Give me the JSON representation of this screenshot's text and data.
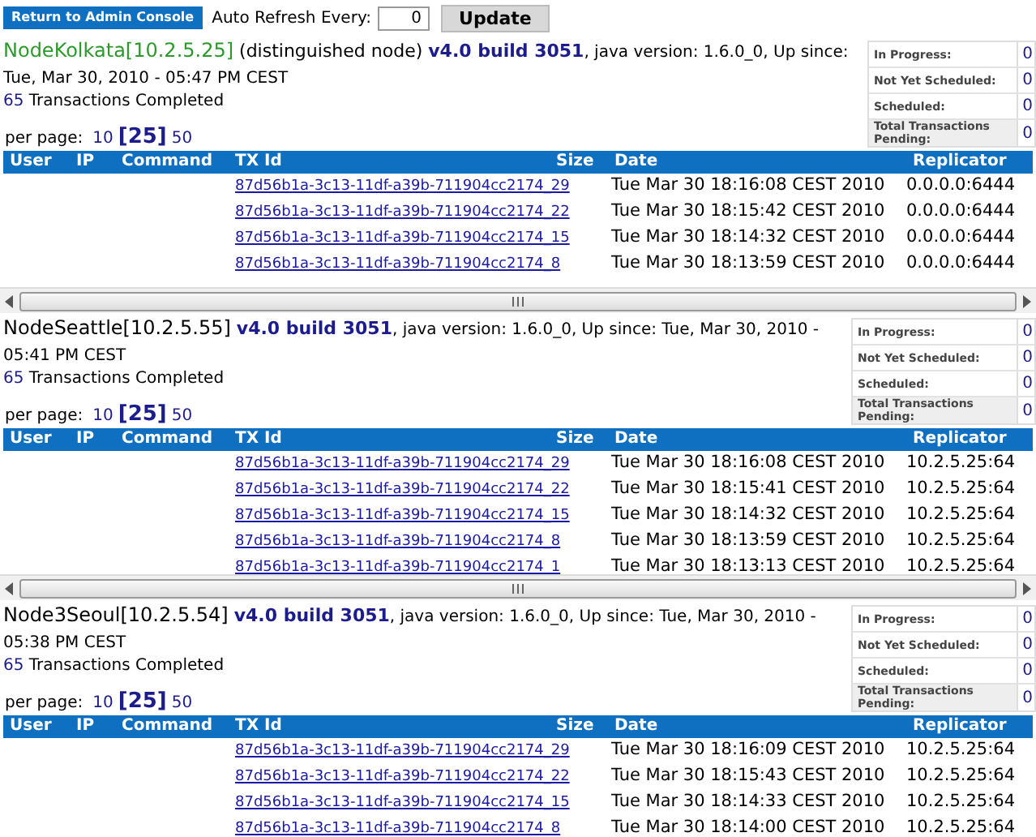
{
  "toolbar": {
    "back_button": "Return to Admin Console",
    "refresh_label": "Auto Refresh Every:",
    "refresh_value": "0",
    "update_button": "Update"
  },
  "nodes": [
    {
      "name": "NodeKolkata[10.2.5.25]",
      "distinguished": true,
      "note": "(distinguished node)",
      "version": "v4.0 build 3051",
      "details": ", java version: 1.6.0_0, Up since: Tue, Mar 30, 2010 - 05:47 PM CEST",
      "completed_count": "65",
      "completed_label": "Transactions Completed",
      "stats": [
        {
          "label": "In Progress:",
          "value": "0"
        },
        {
          "label": "Not Yet Scheduled:",
          "value": "0"
        },
        {
          "label": "Scheduled:",
          "value": "0"
        },
        {
          "label": "Total Transactions Pending:",
          "value": "0"
        }
      ],
      "per_page_label": "per page:",
      "per_page": [
        {
          "label": "10",
          "selected": false
        },
        {
          "label": "[25]",
          "selected": true
        },
        {
          "label": "50",
          "selected": false
        }
      ],
      "columns": [
        "User",
        "IP",
        "Command",
        "TX Id",
        "Size",
        "Date",
        "Replicator"
      ],
      "rows": [
        {
          "tx_id": "87d56b1a-3c13-11df-a39b-711904cc2174_29",
          "date": "Tue Mar 30 18:16:08 CEST 2010",
          "replicator": "0.0.0.0:6444"
        },
        {
          "tx_id": "87d56b1a-3c13-11df-a39b-711904cc2174_22",
          "date": "Tue Mar 30 18:15:42 CEST 2010",
          "replicator": "0.0.0.0:6444"
        },
        {
          "tx_id": "87d56b1a-3c13-11df-a39b-711904cc2174_15",
          "date": "Tue Mar 30 18:14:32 CEST 2010",
          "replicator": "0.0.0.0:6444"
        },
        {
          "tx_id": "87d56b1a-3c13-11df-a39b-711904cc2174_8",
          "date": "Tue Mar 30 18:13:59 CEST 2010",
          "replicator": "0.0.0.0:6444"
        }
      ],
      "horizontal_scrollbar": true
    },
    {
      "name": "NodeSeattle[10.2.5.55]",
      "distinguished": false,
      "version": "v4.0 build 3051",
      "details": ", java version: 1.6.0_0, Up since: Tue, Mar 30, 2010 - 05:41 PM CEST",
      "completed_count": "65",
      "completed_label": "Transactions Completed",
      "stats": [
        {
          "label": "In Progress:",
          "value": "0"
        },
        {
          "label": "Not Yet Scheduled:",
          "value": "0"
        },
        {
          "label": "Scheduled:",
          "value": "0"
        },
        {
          "label": "Total Transactions Pending:",
          "value": "0"
        }
      ],
      "per_page_label": "per page:",
      "per_page": [
        {
          "label": "10",
          "selected": false
        },
        {
          "label": "[25]",
          "selected": true
        },
        {
          "label": "50",
          "selected": false
        }
      ],
      "columns": [
        "User",
        "IP",
        "Command",
        "TX Id",
        "Size",
        "Date",
        "Replicator"
      ],
      "rows": [
        {
          "tx_id": "87d56b1a-3c13-11df-a39b-711904cc2174_29",
          "date": "Tue Mar 30 18:16:08 CEST 2010",
          "replicator": "10.2.5.25:64"
        },
        {
          "tx_id": "87d56b1a-3c13-11df-a39b-711904cc2174_22",
          "date": "Tue Mar 30 18:15:41 CEST 2010",
          "replicator": "10.2.5.25:64"
        },
        {
          "tx_id": "87d56b1a-3c13-11df-a39b-711904cc2174_15",
          "date": "Tue Mar 30 18:14:32 CEST 2010",
          "replicator": "10.2.5.25:64"
        },
        {
          "tx_id": "87d56b1a-3c13-11df-a39b-711904cc2174_8",
          "date": "Tue Mar 30 18:13:59 CEST 2010",
          "replicator": "10.2.5.25:64"
        },
        {
          "tx_id": "87d56b1a-3c13-11df-a39b-711904cc2174_1",
          "date": "Tue Mar 30 18:13:13 CEST 2010",
          "replicator": "10.2.5.25:64"
        }
      ],
      "horizontal_scrollbar": true
    },
    {
      "name": "Node3Seoul[10.2.5.54]",
      "distinguished": false,
      "version": "v4.0 build 3051",
      "details": ", java version: 1.6.0_0, Up since: Tue, Mar 30, 2010 - 05:38 PM CEST",
      "completed_count": "65",
      "completed_label": "Transactions Completed",
      "stats": [
        {
          "label": "In Progress:",
          "value": "0"
        },
        {
          "label": "Not Yet Scheduled:",
          "value": "0"
        },
        {
          "label": "Scheduled:",
          "value": "0"
        },
        {
          "label": "Total Transactions Pending:",
          "value": "0"
        }
      ],
      "per_page_label": "per page:",
      "per_page": [
        {
          "label": "10",
          "selected": false
        },
        {
          "label": "[25]",
          "selected": true
        },
        {
          "label": "50",
          "selected": false
        }
      ],
      "columns": [
        "User",
        "IP",
        "Command",
        "TX Id",
        "Size",
        "Date",
        "Replicator"
      ],
      "rows": [
        {
          "tx_id": "87d56b1a-3c13-11df-a39b-711904cc2174_29",
          "date": "Tue Mar 30 18:16:09 CEST 2010",
          "replicator": "10.2.5.25:64"
        },
        {
          "tx_id": "87d56b1a-3c13-11df-a39b-711904cc2174_22",
          "date": "Tue Mar 30 18:15:43 CEST 2010",
          "replicator": "10.2.5.25:64"
        },
        {
          "tx_id": "87d56b1a-3c13-11df-a39b-711904cc2174_15",
          "date": "Tue Mar 30 18:14:33 CEST 2010",
          "replicator": "10.2.5.25:64"
        },
        {
          "tx_id": "87d56b1a-3c13-11df-a39b-711904cc2174_8",
          "date": "Tue Mar 30 18:14:00 CEST 2010",
          "replicator": "10.2.5.25:64"
        }
      ],
      "horizontal_scrollbar": false
    }
  ]
}
